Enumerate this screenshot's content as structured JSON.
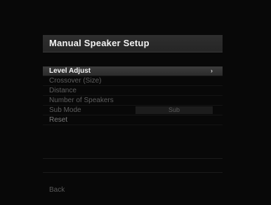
{
  "header": {
    "title": "Manual Speaker Setup"
  },
  "menu": {
    "items": [
      {
        "label": "Level Adjust",
        "chevron": "›"
      },
      {
        "label": "Crossover (Size)"
      },
      {
        "label": "Distance"
      },
      {
        "label": "Number of Speakers"
      },
      {
        "label": "Sub Mode",
        "value": "Sub"
      },
      {
        "label": "Reset"
      }
    ]
  },
  "footer": {
    "back_label": "Back"
  },
  "colors": {
    "background": "#080808",
    "title_bar": "#2a2a2a",
    "selected_row": "#343434",
    "text_active": "#f2f2f2",
    "text_disabled": "#5e5e5e"
  }
}
